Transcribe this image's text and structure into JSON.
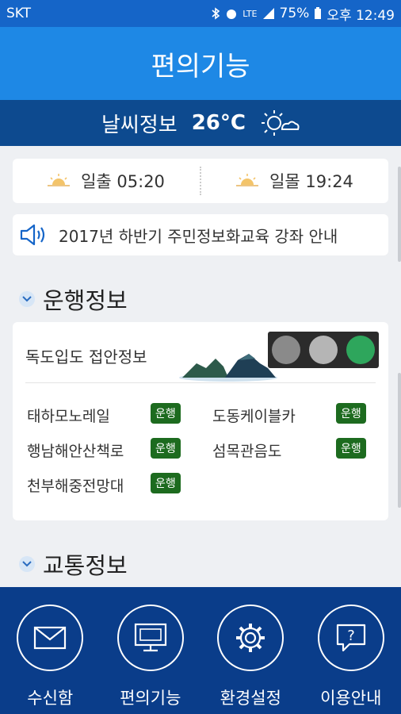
{
  "status_bar": {
    "carrier": "SKT",
    "network": "LTE",
    "battery": "75%",
    "time": "오후 12:49"
  },
  "header": {
    "title": "편의기능"
  },
  "weather": {
    "label": "날씨정보",
    "temperature": "26°C",
    "icon": "partly-cloudy-icon"
  },
  "sun": {
    "sunrise": "일출 05:20",
    "sunset": "일몰 19:24"
  },
  "notice": {
    "text": "2017년 하반기 주민정보화교육 강좌 안내"
  },
  "operation": {
    "section_title": "운행정보",
    "heading": "독도입도 접안정보",
    "routes": [
      {
        "name": "태하모노레일",
        "status": "운행"
      },
      {
        "name": "도동케이블카",
        "status": "운행"
      },
      {
        "name": "행남해안산책로",
        "status": "운행"
      },
      {
        "name": "섬목관음도",
        "status": "운행"
      },
      {
        "name": "천부해중전망대",
        "status": "운행"
      }
    ],
    "traffic_light": {
      "active": "green"
    }
  },
  "traffic": {
    "section_title": "교통정보"
  },
  "bottom_nav": [
    {
      "label": "수신함",
      "icon": "mail-icon"
    },
    {
      "label": "편의기능",
      "icon": "monitor-icon"
    },
    {
      "label": "환경설정",
      "icon": "gear-icon"
    },
    {
      "label": "이용안내",
      "icon": "help-icon"
    }
  ],
  "colors": {
    "appbar": "#1e88e5",
    "weather_bar": "#0d4a8f",
    "bottom_nav": "#0a3d8a",
    "badge": "#1d6b1f"
  }
}
